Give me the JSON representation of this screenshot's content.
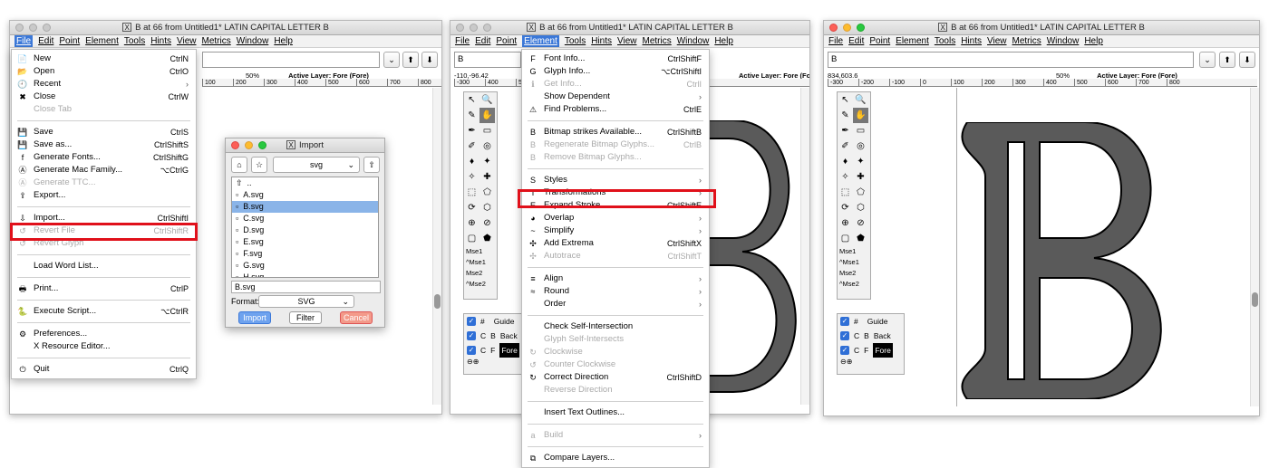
{
  "title": "B at 66 from Untitled1* LATIN CAPITAL LETTER B",
  "menubar": [
    "File",
    "Edit",
    "Point",
    "Element",
    "Tools",
    "Hints",
    "View",
    "Metrics",
    "Window",
    "Help"
  ],
  "glyph_name": "B",
  "ruler_info_1": "Active Layer: Fore (Fore)",
  "zoom": "50%",
  "coords_2": "-110,-96.42",
  "coords_3": "834,603.6",
  "ruler_ticks": [
    "-300",
    "-200",
    "-100",
    "0",
    "100",
    "200",
    "300",
    "400",
    "500",
    "600",
    "700",
    "800"
  ],
  "tool_labels": [
    "Mse1",
    "^Mse1",
    "Mse2",
    "^Mse2"
  ],
  "layers": [
    {
      "c1": "#",
      "c2": "",
      "name": "Guide"
    },
    {
      "c1": "C",
      "c2": "B",
      "name": "Back"
    },
    {
      "c1": "C",
      "c2": "F",
      "name": "Fore"
    }
  ],
  "file_menu": [
    {
      "label": "New",
      "sc": "CtrlN",
      "icon": "📄"
    },
    {
      "label": "Open",
      "sc": "CtrlO",
      "icon": "📂"
    },
    {
      "label": "Recent",
      "sc": "",
      "arrow": true,
      "icon": "🕘"
    },
    {
      "label": "Close",
      "sc": "CtrlW",
      "icon": "✖"
    },
    {
      "label": "Close Tab",
      "sc": "",
      "dis": true
    },
    {
      "sep": true
    },
    {
      "label": "Save",
      "sc": "CtrlS",
      "icon": "💾"
    },
    {
      "label": "Save as...",
      "sc": "CtrlShiftS",
      "icon": "💾"
    },
    {
      "label": "Generate Fonts...",
      "sc": "CtrlShiftG",
      "icon": "f"
    },
    {
      "label": "Generate Mac Family...",
      "sc": "⌥CtrlG",
      "icon": "Ⓐ"
    },
    {
      "label": "Generate TTC...",
      "sc": "",
      "dis": true,
      "icon": "Ⓐ"
    },
    {
      "label": "Export...",
      "sc": "",
      "icon": "⇪"
    },
    {
      "sep": true
    },
    {
      "label": "Import...",
      "sc": "CtrlShiftI",
      "icon": "⇩"
    },
    {
      "label": "Revert File",
      "sc": "CtrlShiftR",
      "dis": true,
      "icon": "↺"
    },
    {
      "label": "Revert Glyph",
      "sc": "",
      "dis": true,
      "icon": "↺"
    },
    {
      "sep": true
    },
    {
      "label": "Load Word List...",
      "sc": ""
    },
    {
      "sep": true
    },
    {
      "label": "Print...",
      "sc": "CtrlP",
      "icon": "🖶"
    },
    {
      "sep": true
    },
    {
      "label": "Execute Script...",
      "sc": "⌥CtrlR",
      "icon": "🐍"
    },
    {
      "sep": true
    },
    {
      "label": "Preferences...",
      "sc": "",
      "icon": "⚙"
    },
    {
      "label": "X Resource Editor...",
      "sc": ""
    },
    {
      "sep": true
    },
    {
      "label": "Quit",
      "sc": "CtrlQ",
      "icon": "⏻"
    }
  ],
  "element_menu": [
    {
      "label": "Font Info...",
      "sc": "CtrlShiftF",
      "icon": "F"
    },
    {
      "label": "Glyph Info...",
      "sc": "⌥CtrlShiftI",
      "icon": "G"
    },
    {
      "label": "Get Info...",
      "sc": "CtrlI",
      "dis": true,
      "icon": "ℹ"
    },
    {
      "label": "Show Dependent",
      "sc": "",
      "arrow": true
    },
    {
      "label": "Find Problems...",
      "sc": "CtrlE",
      "icon": "⚠"
    },
    {
      "sep": true
    },
    {
      "label": "Bitmap strikes Available...",
      "sc": "CtrlShiftB",
      "icon": "B"
    },
    {
      "label": "Regenerate Bitmap Glyphs...",
      "sc": "CtrlB",
      "dis": true,
      "icon": "B"
    },
    {
      "label": "Remove Bitmap Glyphs...",
      "sc": "",
      "dis": true,
      "icon": "B"
    },
    {
      "sep": true
    },
    {
      "label": "Styles",
      "sc": "",
      "arrow": true,
      "icon": "S"
    },
    {
      "label": "Transformations",
      "sc": "",
      "arrow": true,
      "icon": "T"
    },
    {
      "label": "Expand Stroke...",
      "sc": "CtrlShiftE",
      "icon": "E"
    },
    {
      "label": "Overlap",
      "sc": "",
      "arrow": true,
      "icon": "◕"
    },
    {
      "label": "Simplify",
      "sc": "",
      "arrow": true,
      "icon": "~"
    },
    {
      "label": "Add Extrema",
      "sc": "CtrlShiftX",
      "icon": "✣"
    },
    {
      "label": "Autotrace",
      "sc": "CtrlShiftT",
      "dis": true,
      "icon": "✣"
    },
    {
      "sep": true
    },
    {
      "label": "Align",
      "sc": "",
      "arrow": true,
      "icon": "≡"
    },
    {
      "label": "Round",
      "sc": "",
      "arrow": true,
      "icon": "≈"
    },
    {
      "label": "Order",
      "sc": "",
      "arrow": true
    },
    {
      "sep": true
    },
    {
      "label": "Check Self-Intersection",
      "sc": ""
    },
    {
      "label": "Glyph Self-Intersects",
      "sc": "",
      "dis": true
    },
    {
      "label": "Clockwise",
      "sc": "",
      "dis": true,
      "icon": "↻"
    },
    {
      "label": "Counter Clockwise",
      "sc": "",
      "dis": true,
      "icon": "↺"
    },
    {
      "label": "Correct Direction",
      "sc": "CtrlShiftD",
      "icon": "↻"
    },
    {
      "label": "Reverse Direction",
      "sc": "",
      "dis": true
    },
    {
      "sep": true
    },
    {
      "label": "Insert Text Outlines...",
      "sc": ""
    },
    {
      "sep": true
    },
    {
      "label": "Build",
      "sc": "",
      "arrow": true,
      "dis": true,
      "icon": "a"
    },
    {
      "sep": true
    },
    {
      "label": "Compare Layers...",
      "sc": "",
      "icon": "⧉"
    }
  ],
  "import_dialog": {
    "title": "Import",
    "dir": "svg",
    "files": [
      "..",
      "A.svg",
      "B.svg",
      "C.svg",
      "D.svg",
      "E.svg",
      "F.svg",
      "G.svg",
      "H.svg"
    ],
    "selected": "B.svg",
    "filename": "B.svg",
    "format_label": "Format:",
    "format": "SVG",
    "import_btn": "Import",
    "filter_btn": "Filter",
    "cancel_btn": "Cancel"
  },
  "colors": {
    "accent": "#3b78d8",
    "highlight": "#e0101a",
    "glyph_fill": "#5a5a5a"
  }
}
